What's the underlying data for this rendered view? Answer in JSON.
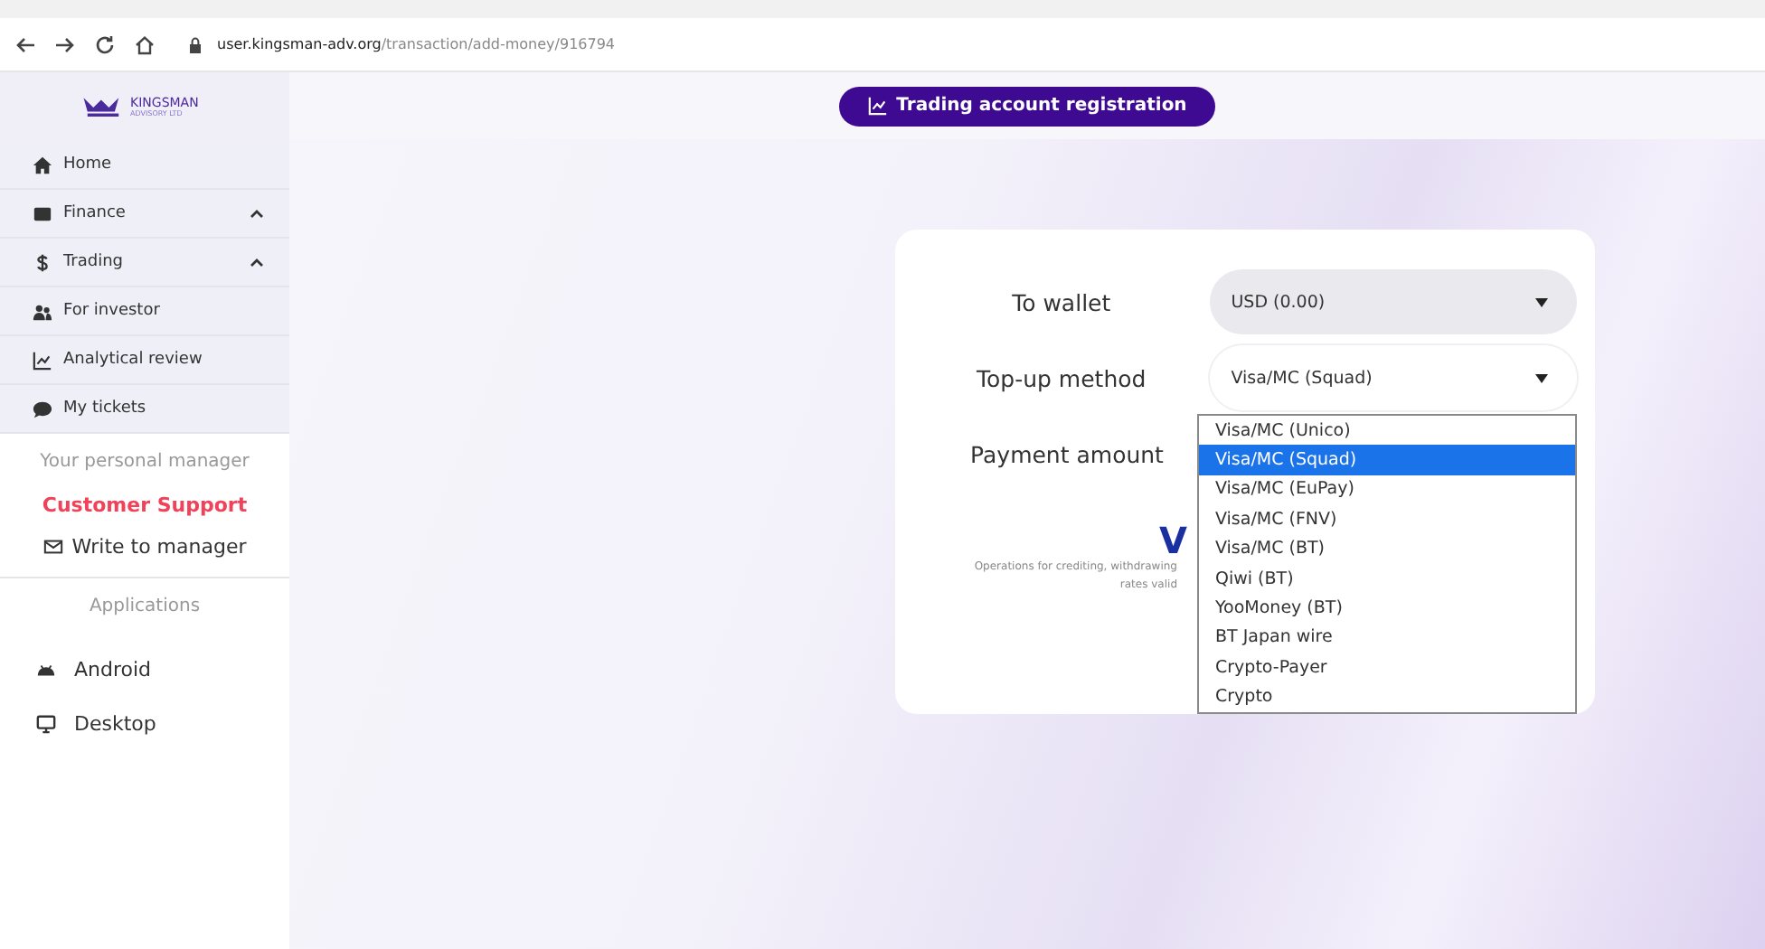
{
  "browser": {
    "url_host": "user.kingsman-adv.org",
    "url_path": "/transaction/add-money/916794"
  },
  "logo": {
    "name": "KINGSMAN",
    "subtitle": "ADVISORY LTD"
  },
  "sidebar": {
    "items": [
      {
        "label": "Home"
      },
      {
        "label": "Finance",
        "expanded": true
      },
      {
        "label": "Trading",
        "expanded": true
      },
      {
        "label": "For investor"
      },
      {
        "label": "Analytical review"
      },
      {
        "label": "My tickets"
      }
    ],
    "manager_heading": "Your personal manager",
    "manager_name": "Customer Support",
    "write_link": "Write to manager",
    "apps_heading": "Applications",
    "apps": [
      {
        "label": "Android"
      },
      {
        "label": "Desktop"
      }
    ]
  },
  "top_button": "Trading account registration",
  "form": {
    "fields": [
      {
        "label": "To wallet",
        "value": "USD (0.00)",
        "kind": "select",
        "shaded": true
      },
      {
        "label": "Top-up method",
        "value": "Visa/MC (Squad)",
        "kind": "select",
        "shaded": false
      },
      {
        "label": "Payment amount",
        "kind": "hidden"
      }
    ],
    "logo_letter": "V",
    "note_line_1": "Operations for crediting, withdrawing",
    "note_line_2": "rates valid"
  },
  "dropdown": {
    "options": [
      {
        "label": "Visa/MC (Unico)",
        "selected": false
      },
      {
        "label": "Visa/MC (Squad)",
        "selected": true
      },
      {
        "label": "Visa/MC (EuPay)",
        "selected": false
      },
      {
        "label": "Visa/MC (FNV)",
        "selected": false
      },
      {
        "label": "Visa/MC (BT)",
        "selected": false
      },
      {
        "label": "Qiwi (BT)",
        "selected": false
      },
      {
        "label": "YooMoney (BT)",
        "selected": false
      },
      {
        "label": "BT Japan wire",
        "selected": false
      },
      {
        "label": "Crypto-Payer",
        "selected": false
      },
      {
        "label": "Crypto",
        "selected": false
      }
    ]
  }
}
